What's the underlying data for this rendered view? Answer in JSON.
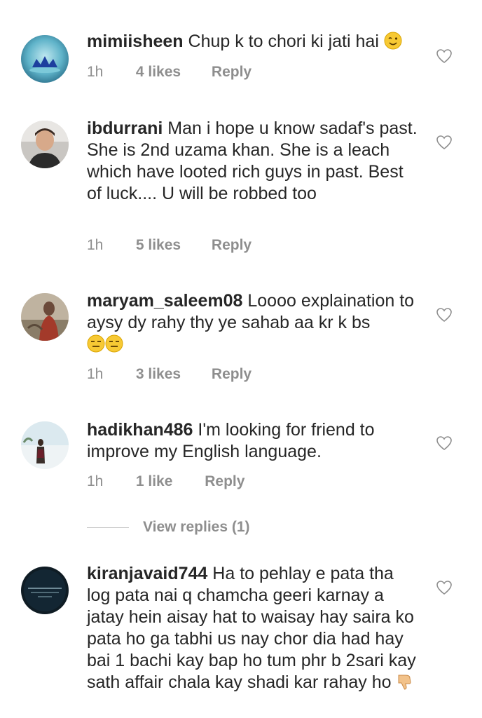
{
  "comments": [
    {
      "username": "mimiisheen",
      "text": "Chup k to chori ki jati hai",
      "emoji": "wink-emoji",
      "time": "1h",
      "likes": "4 likes",
      "reply": "Reply"
    },
    {
      "username": "ibdurrani",
      "text": "Man i hope u know sadaf's past. She is 2nd uzama khan. She is a leach which have looted rich guys in past. Best of luck.... U will be robbed too",
      "time": "1h",
      "likes": "5 likes",
      "reply": "Reply"
    },
    {
      "username": "maryam_saleem08",
      "text": "Loooo explaination to aysy dy rahy thy ye sahab aa kr k bs",
      "emoji": "expressionless-emoji",
      "time": "1h",
      "likes": "3 likes",
      "reply": "Reply"
    },
    {
      "username": "hadikhan486",
      "text": "I'm looking for friend to improve my English language.",
      "time": "1h",
      "likes": "1 like",
      "reply": "Reply",
      "view_replies": "View replies (1)"
    },
    {
      "username": "kiranjavaid744",
      "text": "Ha to pehlay e pata tha log pata nai q chamcha geeri karnay a jatay hein aisay hat to waisay hay saira ko pata ho ga tabhi us nay chor dia had hay bai 1 bachi kay bap ho tum phr b 2sari kay sath affair chala kay shadi kar rahay ho",
      "emoji": "thumbs-down-emoji"
    }
  ],
  "icons": {
    "like": "heart-outline-icon"
  },
  "colors": {
    "text": "#262626",
    "secondary": "#8e8e8e"
  }
}
